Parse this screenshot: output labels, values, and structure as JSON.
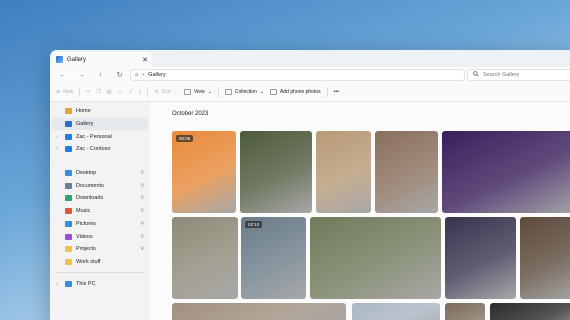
{
  "window": {
    "tab_title": "Gallery",
    "close_glyph": "✕"
  },
  "address": {
    "breadcrumb": "Gallery",
    "search_placeholder": "Search Gallery"
  },
  "nav": {
    "back": "←",
    "forward": "→",
    "up": "↑",
    "refresh": "↻",
    "home": "⌂",
    "sep": "›"
  },
  "toolbar": {
    "new": "New",
    "sort": "Sort",
    "view": "View",
    "collection": "Collection",
    "add_phone": "Add phone photos",
    "more": "•••"
  },
  "sidebar": {
    "top": [
      {
        "label": "Home",
        "icon": "home-icon",
        "color": "#e0a43a"
      },
      {
        "label": "Gallery",
        "icon": "gallery-icon",
        "color": "#2b6dc9"
      },
      {
        "label": "Zac - Personal",
        "icon": "cloud-icon",
        "color": "#1f7fe0"
      },
      {
        "label": "Zac - Contoso",
        "icon": "cloud-icon",
        "color": "#1f7fe0"
      }
    ],
    "pinned": [
      {
        "label": "Desktop",
        "icon": "desktop-icon",
        "color": "#3a8ddb"
      },
      {
        "label": "Documents",
        "icon": "documents-icon",
        "color": "#6a7f96"
      },
      {
        "label": "Downloads",
        "icon": "downloads-icon",
        "color": "#2aa66a"
      },
      {
        "label": "Music",
        "icon": "music-icon",
        "color": "#e0543a"
      },
      {
        "label": "Pictures",
        "icon": "pictures-icon",
        "color": "#3a8ddb"
      },
      {
        "label": "Videos",
        "icon": "videos-icon",
        "color": "#9b4fd0"
      },
      {
        "label": "Projects",
        "icon": "folder-icon",
        "color": "#f0c24b"
      },
      {
        "label": "Work stuff",
        "icon": "folder-icon",
        "color": "#f0c24b"
      }
    ],
    "this_pc": {
      "label": "This PC",
      "icon": "pc-icon",
      "color": "#3a8ddb"
    }
  },
  "gallery": {
    "group_label": "October 2023",
    "video_badges": [
      "00:06",
      "02:10"
    ],
    "photo_colors": [
      "#e88a3a",
      "#4e5a3c",
      "#b89a76",
      "#8a6f5c",
      "#3a1f5c",
      "#8e8a78",
      "#6a7c88",
      "#6f7a5a",
      "#3a3350",
      "#5c4a3c",
      "#a09080",
      "#aab7c4",
      "#7a6a5a",
      "#2a2a2a"
    ]
  }
}
